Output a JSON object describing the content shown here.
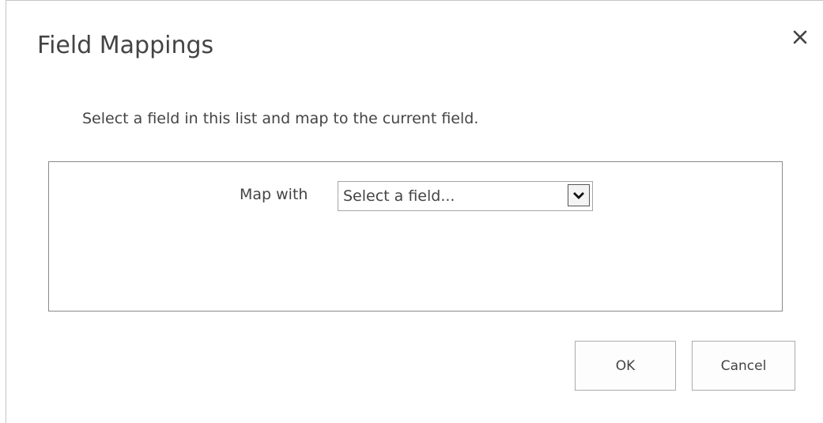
{
  "dialog": {
    "title": "Field Mappings",
    "close_icon": "close-icon",
    "instruction": "Select a field in this list and map to the current field."
  },
  "mapping": {
    "label": "Map with",
    "select_value": "Select a field...",
    "arrow_icon": "chevron-down-icon"
  },
  "buttons": {
    "ok_label": "OK",
    "cancel_label": "Cancel"
  },
  "colors": {
    "text": "#444444",
    "panel_border": "#8a8a8a",
    "button_border": "#ababab"
  }
}
